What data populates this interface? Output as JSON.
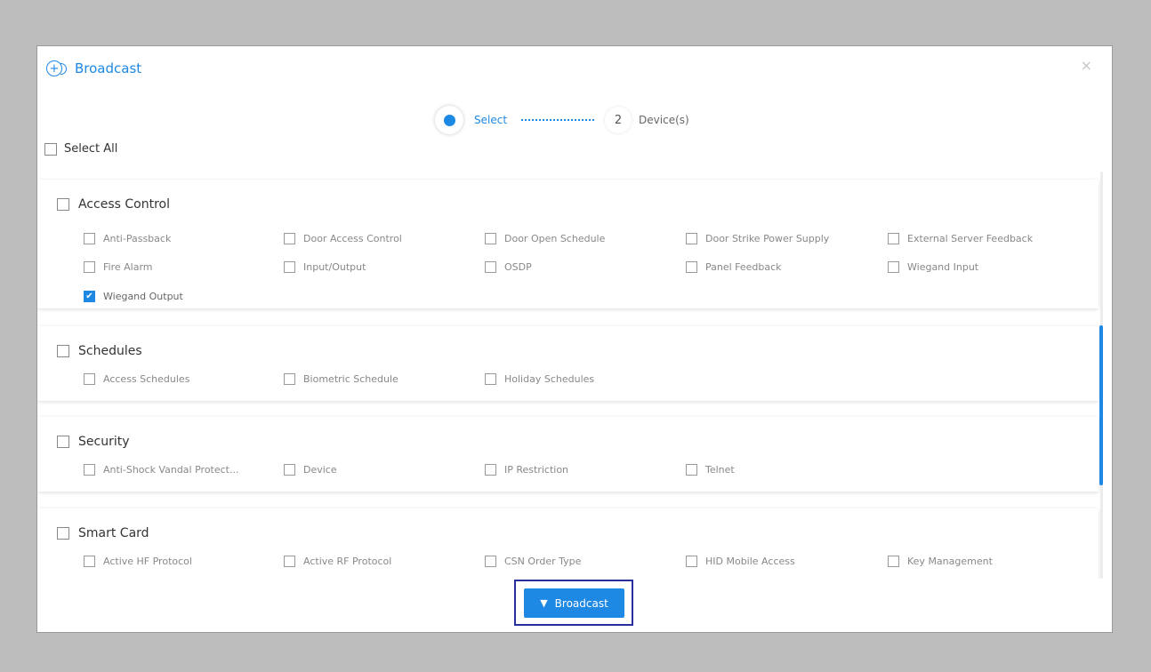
{
  "dialog": {
    "title": "Broadcast",
    "close": "×"
  },
  "stepper": {
    "steps": [
      {
        "label": "Select",
        "active": true
      },
      {
        "number": "2",
        "label": "Device(s)",
        "active": false
      }
    ]
  },
  "select_all": {
    "label": "Select All",
    "checked": false
  },
  "sections": [
    {
      "title": "Access Control",
      "items": [
        {
          "label": "Anti-Passback",
          "checked": false
        },
        {
          "label": "Door Access Control",
          "checked": false
        },
        {
          "label": "Door Open Schedule",
          "checked": false
        },
        {
          "label": "Door Strike Power Supply",
          "checked": false
        },
        {
          "label": "External Server Feedback",
          "checked": false
        },
        {
          "label": "Fire Alarm",
          "checked": false
        },
        {
          "label": "Input/Output",
          "checked": false
        },
        {
          "label": "OSDP",
          "checked": false
        },
        {
          "label": "Panel Feedback",
          "checked": false
        },
        {
          "label": "Wiegand Input",
          "checked": false
        },
        {
          "label": "Wiegand Output",
          "checked": true
        }
      ]
    },
    {
      "title": "Schedules",
      "items": [
        {
          "label": "Access Schedules",
          "checked": false
        },
        {
          "label": "Biometric Schedule",
          "checked": false
        },
        {
          "label": "Holiday Schedules",
          "checked": false
        }
      ]
    },
    {
      "title": "Security",
      "items": [
        {
          "label": "Anti-Shock Vandal Protect...",
          "checked": false
        },
        {
          "label": "Device",
          "checked": false
        },
        {
          "label": "IP Restriction",
          "checked": false
        },
        {
          "label": "Telnet",
          "checked": false
        }
      ]
    },
    {
      "title": "Smart Card",
      "items": [
        {
          "label": "Active HF Protocol",
          "checked": false
        },
        {
          "label": "Active RF Protocol",
          "checked": false
        },
        {
          "label": "CSN Order Type",
          "checked": false
        },
        {
          "label": "HID Mobile Access",
          "checked": false
        },
        {
          "label": "Key Management",
          "checked": false
        }
      ]
    }
  ],
  "footer": {
    "broadcast_label": "Broadcast"
  },
  "colors": {
    "accent": "#1e88e5",
    "focus_outline": "#2a2fa0",
    "overlay": "#bdbdbd"
  },
  "icons": {
    "title_icon": "broadcast-icon",
    "button_icon": "wifi-icon",
    "close_icon": "close-icon"
  }
}
